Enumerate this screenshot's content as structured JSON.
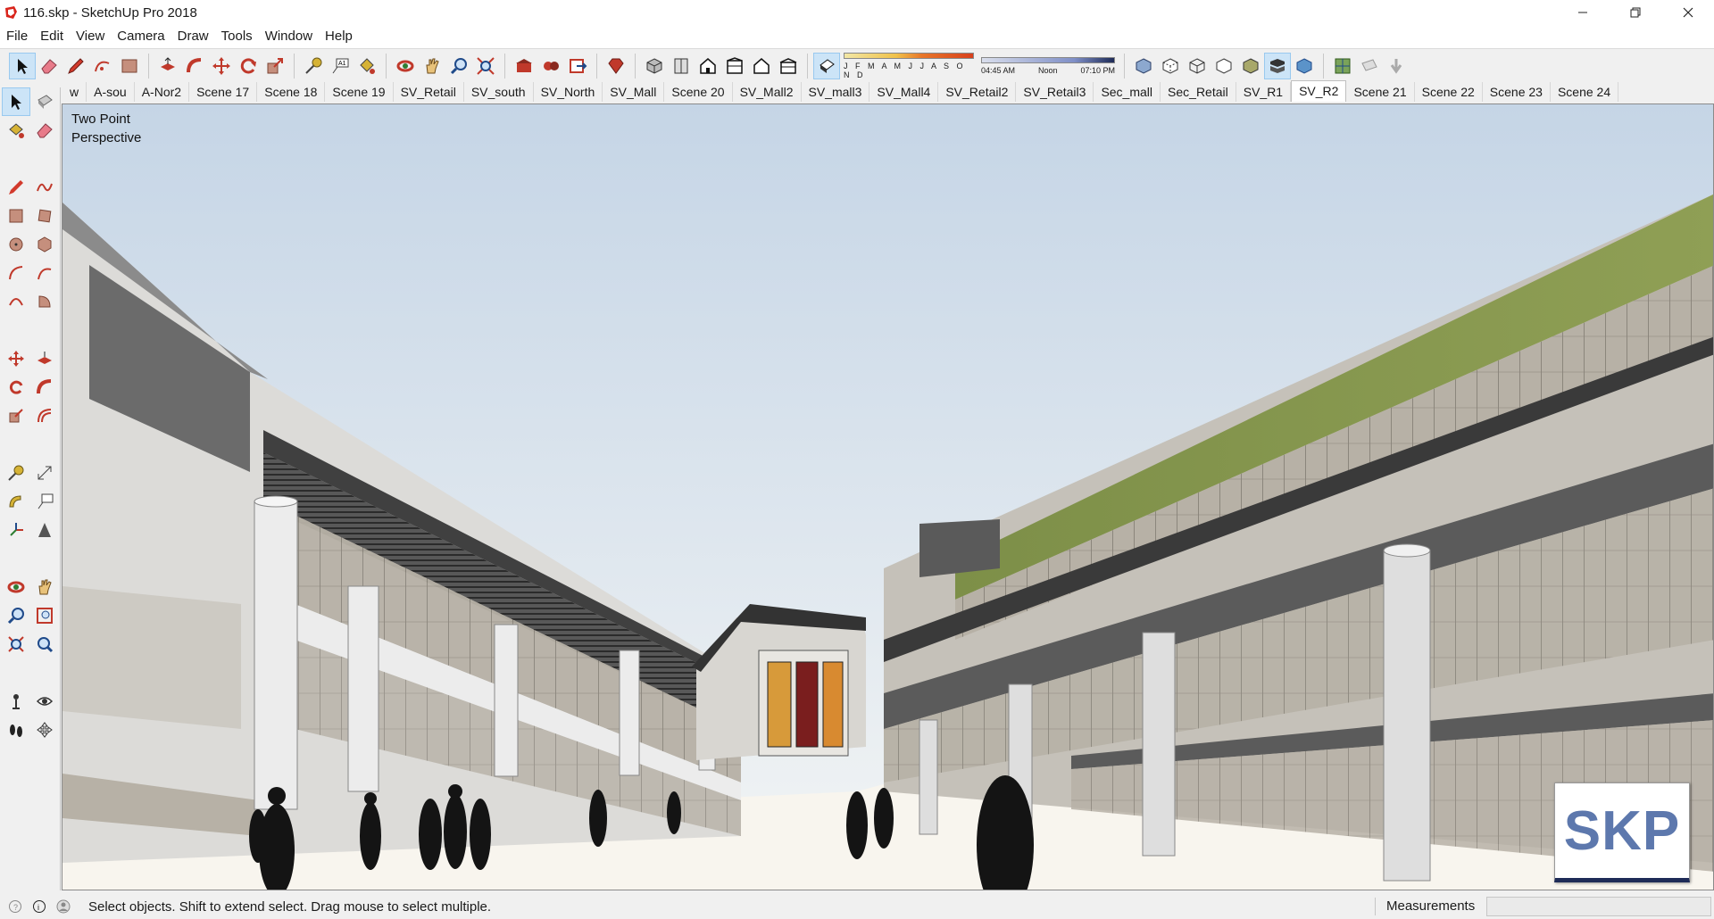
{
  "window": {
    "title": "116.skp - SketchUp Pro 2018",
    "controls": [
      "minimize-icon",
      "restore-icon",
      "close-icon"
    ]
  },
  "menu": [
    "File",
    "Edit",
    "View",
    "Camera",
    "Draw",
    "Tools",
    "Window",
    "Help"
  ],
  "toolbar": {
    "tools": [
      "select-icon",
      "eraser-icon",
      "pencil-icon",
      "freehand-arc-icon",
      "rectangle-icon",
      "pushpull-icon",
      "followme-icon",
      "move-icon",
      "rotate-icon",
      "scale-icon",
      "tape-measure-icon",
      "text-icon",
      "paint-bucket-icon",
      "orbit-icon",
      "pan-icon",
      "zoom-icon",
      "zoom-extents-icon",
      "warehouse-icon",
      "extension-warehouse-icon",
      "send-to-layout-icon",
      "ruby-icon",
      "iso-view-icon",
      "top-view-icon",
      "front-view-icon",
      "right-view-icon",
      "back-view-icon",
      "left-view-icon",
      "shadows-toggle-icon"
    ],
    "shadow_months": "J F M A M J J A S O N D",
    "shadow_times": [
      "04:45 AM",
      "Noon",
      "07:10 PM"
    ],
    "style_tools": [
      "xray-icon",
      "back-edges-icon",
      "wireframe-icon",
      "hidden-line-icon",
      "shaded-icon",
      "shaded-textures-icon",
      "monochrome-icon"
    ],
    "extra_tools": [
      "model-info-icon",
      "section-plane-icon",
      "section-display-icon"
    ]
  },
  "scenes": {
    "tabs": [
      "w",
      "A-sou",
      "A-Nor2",
      "Scene 17",
      "Scene 18",
      "Scene 19",
      "SV_Retail",
      "SV_south",
      "SV_North",
      "SV_Mall",
      "Scene 20",
      "SV_Mall2",
      "SV_mall3",
      "SV_Mall4",
      "SV_Retail2",
      "SV_Retail3",
      "Sec_mall",
      "Sec_Retail",
      "SV_R1",
      "SV_R2",
      "Scene 21",
      "Scene 22",
      "Scene 23",
      "Scene 24"
    ],
    "active": "SV_R2"
  },
  "palette": {
    "tools": [
      "select-icon",
      "make-component-icon",
      "paint-bucket-icon",
      "eraser-icon",
      "line-icon",
      "freehand-icon",
      "rectangle-icon",
      "rotated-rectangle-icon",
      "circle-icon",
      "polygon-icon",
      "arc-icon",
      "two-point-arc-icon",
      "three-point-arc-icon",
      "pie-icon",
      "move-icon",
      "pushpull-icon",
      "rotate-icon",
      "followme-icon",
      "scale-icon",
      "offset-icon",
      "tape-measure-icon",
      "dimension-icon",
      "protractor-icon",
      "text-icon",
      "axes-icon",
      "3d-text-icon",
      "orbit-icon",
      "pan-icon",
      "zoom-icon",
      "zoom-window-icon",
      "zoom-extents-icon",
      "previous-view-icon",
      "position-camera-icon",
      "look-around-icon",
      "walk-icon",
      "section-plane-icon"
    ]
  },
  "viewport": {
    "camera_label": "Two Point\nPerspective",
    "badge": "SKP"
  },
  "status": {
    "icons": [
      "geo-location-icon",
      "credits-icon",
      "user-icon"
    ],
    "text": "Select objects. Shift to extend select. Drag mouse to select multiple.",
    "measurements_label": "Measurements",
    "measurements_value": ""
  },
  "colors": {
    "sky_top": "#c7d6e6",
    "sky_bottom": "#f4f6f6",
    "ground": "#f7f4ec",
    "roof_green": "#7d8f48",
    "selection": "#cce4f7"
  }
}
